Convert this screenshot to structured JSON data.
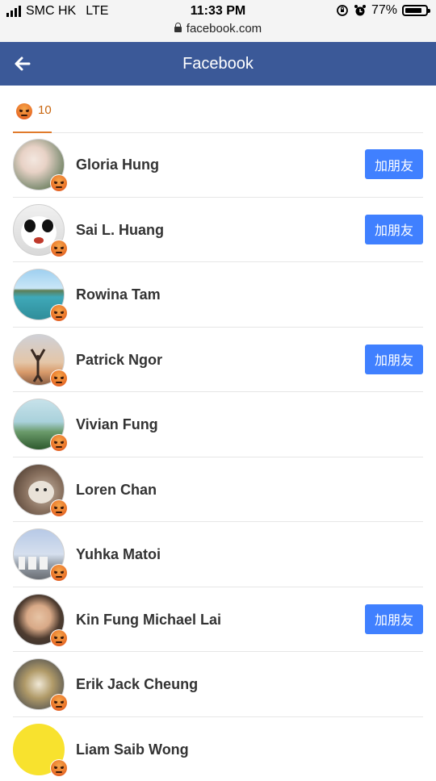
{
  "status_bar": {
    "carrier": "SMC HK",
    "network": "LTE",
    "time": "11:33 PM",
    "battery": "77%",
    "url": "facebook.com"
  },
  "app_bar": {
    "title": "Facebook"
  },
  "reaction_tab": {
    "icon": "angry-reaction-icon",
    "count": "10",
    "accent_color": "#e07a2b"
  },
  "colors": {
    "header_bg": "#3b5998",
    "add_button_bg": "#4080ff"
  },
  "people": [
    {
      "name": "Gloria Hung",
      "button": "加朋友"
    },
    {
      "name": "Sai L. Huang",
      "button": "加朋友"
    },
    {
      "name": "Rowina Tam"
    },
    {
      "name": "Patrick Ngor",
      "button": "加朋友"
    },
    {
      "name": "Vivian Fung"
    },
    {
      "name": "Loren Chan"
    },
    {
      "name": "Yuhka Matoi"
    },
    {
      "name": "Kin Fung Michael Lai",
      "button": "加朋友"
    },
    {
      "name": "Erik Jack Cheung"
    },
    {
      "name": "Liam Saib Wong"
    }
  ]
}
